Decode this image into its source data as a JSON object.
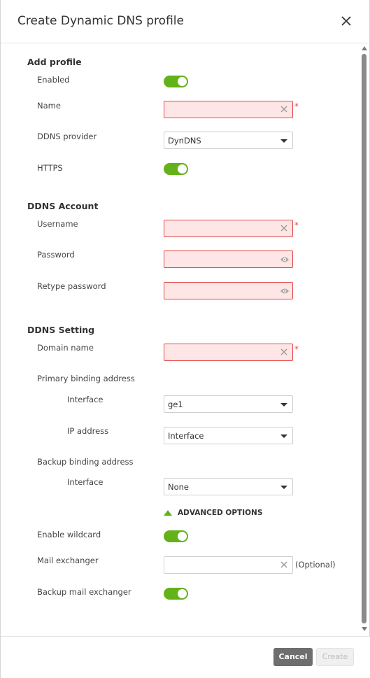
{
  "dialog": {
    "title": "Create Dynamic DNS profile"
  },
  "add_profile": {
    "title": "Add profile",
    "enabled_label": "Enabled",
    "enabled_on": true,
    "name_label": "Name",
    "name_value": "",
    "name_required": "*",
    "provider_label": "DDNS provider",
    "provider_value": "DynDNS",
    "https_label": "HTTPS",
    "https_on": true
  },
  "ddns_account": {
    "title": "DDNS Account",
    "username_label": "Username",
    "username_value": "",
    "username_required": "*",
    "password_label": "Password",
    "password_value": "",
    "retype_label": "Retype password",
    "retype_value": ""
  },
  "ddns_setting": {
    "title": "DDNS Setting",
    "domain_label": "Domain name",
    "domain_value": "",
    "domain_required": "*",
    "primary_label": "Primary binding address",
    "primary_interface_label": "Interface",
    "primary_interface_value": "ge1",
    "primary_ip_label": "IP address",
    "primary_ip_value": "Interface",
    "backup_label": "Backup binding address",
    "backup_interface_label": "Interface",
    "backup_interface_value": "None"
  },
  "advanced": {
    "label": "ADVANCED OPTIONS",
    "wildcard_label": "Enable wildcard",
    "wildcard_on": true,
    "mail_label": "Mail exchanger",
    "mail_value": "",
    "mail_optional": "(Optional)",
    "backup_mail_label": "Backup mail exchanger",
    "backup_mail_on": true
  },
  "footer": {
    "cancel_label": "Cancel",
    "create_label": "Create"
  },
  "colors": {
    "accent_green": "#64b21a",
    "error_red": "#e04a4a",
    "error_bg": "#ffe6e6"
  }
}
